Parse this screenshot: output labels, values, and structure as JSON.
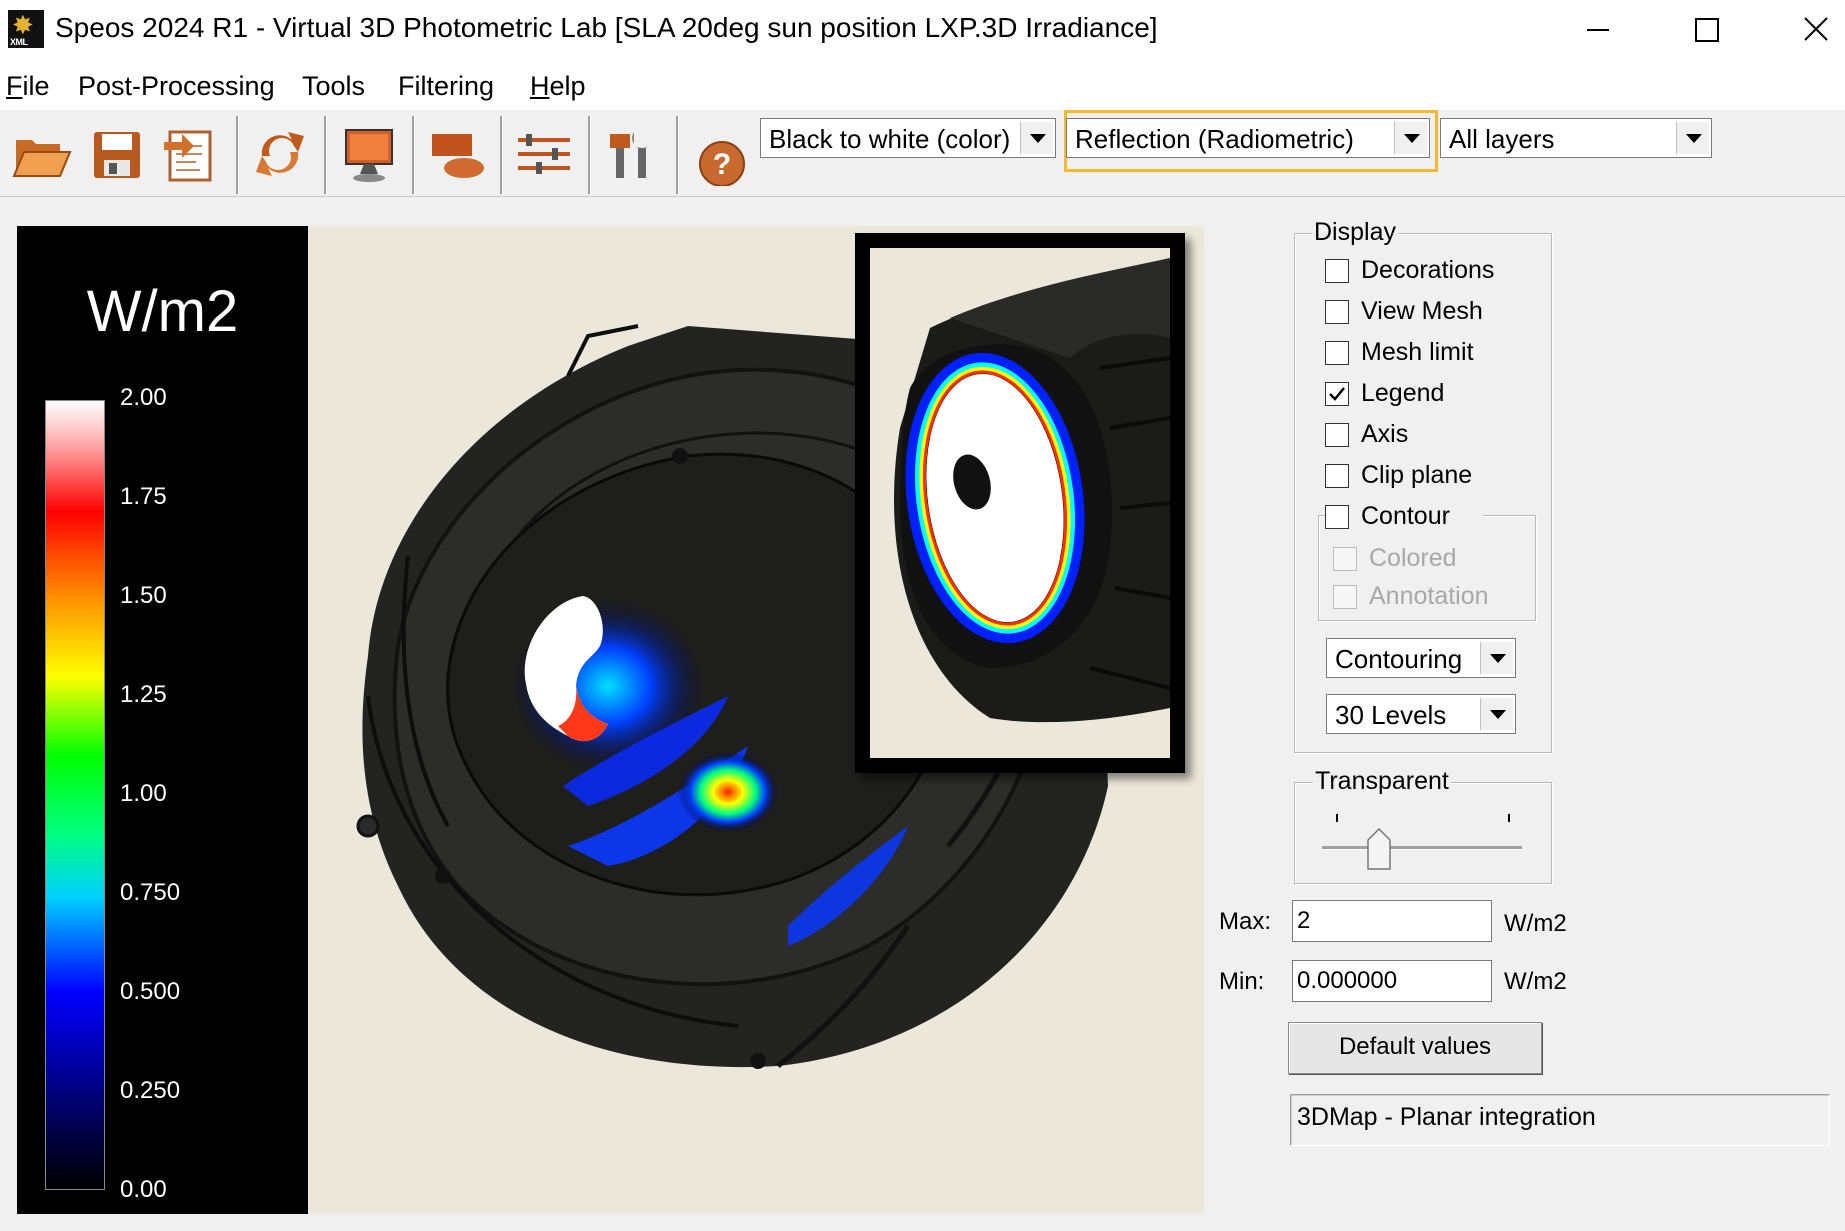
{
  "window": {
    "title": "Speos 2024 R1 - Virtual 3D Photometric Lab [SLA 20deg sun position LXP.3D Irradiance]",
    "app_icon_text": "XML"
  },
  "menu": {
    "file": {
      "mnemonic": "F",
      "rest": "ile"
    },
    "post_processing": "Post-Processing",
    "tools": "Tools",
    "filtering": "Filtering",
    "help": {
      "mnemonic": "H",
      "rest": "elp"
    }
  },
  "toolbar": {
    "color_map": "Black to white (color)",
    "measure_type": "Reflection (Radiometric)",
    "layers": "All layers",
    "icons": [
      "open-folder-icon",
      "save-icon",
      "export-icon",
      "refresh-icon",
      "display-icon",
      "surface-icon",
      "settings-sliders-icon",
      "tools-icon",
      "help-icon"
    ]
  },
  "legend": {
    "unit": "W/m2",
    "ticks": [
      "2.00",
      "1.75",
      "1.50",
      "1.25",
      "1.00",
      "0.750",
      "0.500",
      "0.250",
      "0.00"
    ]
  },
  "display": {
    "group_title": "Display",
    "options": [
      {
        "label": "Decorations",
        "checked": false
      },
      {
        "label": "View Mesh",
        "checked": false
      },
      {
        "label": "Mesh limit",
        "checked": false
      },
      {
        "label": "Legend",
        "checked": true
      },
      {
        "label": "Axis",
        "checked": false
      },
      {
        "label": "Clip plane",
        "checked": false
      },
      {
        "label": "Contour",
        "checked": false
      }
    ],
    "contour_options": [
      {
        "label": "Colored",
        "checked": false,
        "enabled": false
      },
      {
        "label": "Annotation",
        "checked": false,
        "enabled": false
      }
    ],
    "contour_mode": "Contouring",
    "levels": "30 Levels"
  },
  "transparent": {
    "group_title": "Transparent",
    "value": 0.25
  },
  "range": {
    "max_label": "Max:",
    "max_value": "2",
    "min_label": "Min:",
    "min_value": "0.000000",
    "unit": "W/m2"
  },
  "default_button": "Default values",
  "status": "3DMap - Planar integration"
}
